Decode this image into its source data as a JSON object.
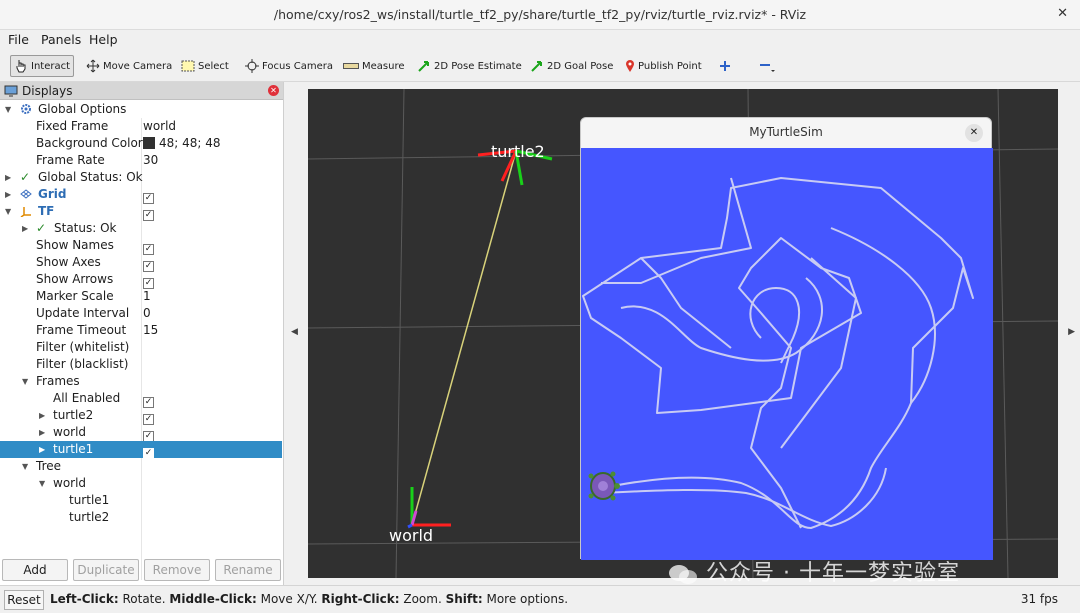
{
  "window": {
    "title": "/home/cxy/ros2_ws/install/turtle_tf2_py/share/turtle_tf2_py/rviz/turtle_rviz.rviz* - RViz",
    "close": "✕"
  },
  "menu": {
    "file": "File",
    "panels": "Panels",
    "help": "Help"
  },
  "toolbar": {
    "interact": "Interact",
    "move_camera": "Move Camera",
    "select": "Select",
    "focus_camera": "Focus Camera",
    "measure": "Measure",
    "pose_estimate": "2D Pose Estimate",
    "goal_pose": "2D Goal Pose",
    "publish_point": "Publish Point"
  },
  "displays": {
    "title": "Displays",
    "rows": [
      {
        "label": "Global Options",
        "value": ""
      },
      {
        "label": "Fixed Frame",
        "value": "world"
      },
      {
        "label": "Background Color",
        "value": "48; 48; 48"
      },
      {
        "label": "Frame Rate",
        "value": "30"
      },
      {
        "label": "Global Status: Ok",
        "value": ""
      },
      {
        "label": "Grid",
        "value": ""
      },
      {
        "label": "TF",
        "value": ""
      },
      {
        "label": "Status: Ok",
        "value": ""
      },
      {
        "label": "Show Names",
        "value": ""
      },
      {
        "label": "Show Axes",
        "value": ""
      },
      {
        "label": "Show Arrows",
        "value": ""
      },
      {
        "label": "Marker Scale",
        "value": "1"
      },
      {
        "label": "Update Interval",
        "value": "0"
      },
      {
        "label": "Frame Timeout",
        "value": "15"
      },
      {
        "label": "Filter (whitelist)",
        "value": ""
      },
      {
        "label": "Filter (blacklist)",
        "value": ""
      },
      {
        "label": "Frames",
        "value": ""
      },
      {
        "label": "All Enabled",
        "value": ""
      },
      {
        "label": "turtle2",
        "value": ""
      },
      {
        "label": "world",
        "value": ""
      },
      {
        "label": "turtle1",
        "value": ""
      },
      {
        "label": "Tree",
        "value": ""
      },
      {
        "label": "world",
        "value": ""
      },
      {
        "label": "turtle1",
        "value": ""
      },
      {
        "label": "turtle2",
        "value": ""
      }
    ],
    "buttons": {
      "add": "Add",
      "duplicate": "Duplicate",
      "remove": "Remove",
      "rename": "Rename"
    }
  },
  "viewport": {
    "label_turtle": "turtle2",
    "label_world": "world"
  },
  "turtlesim": {
    "title": "MyTurtleSim",
    "close": "✕",
    "bg_color": "#4556ff"
  },
  "status": {
    "reset": "Reset",
    "left_click": "Left-Click:",
    "left_action": " Rotate. ",
    "middle_click": "Middle-Click:",
    "middle_action": " Move X/Y. ",
    "right_click": "Right-Click:",
    "right_action": " Zoom. ",
    "shift": "Shift:",
    "shift_action": " More options.",
    "fps": "31 fps"
  },
  "watermark": "公众号 · 十年一梦实验室"
}
